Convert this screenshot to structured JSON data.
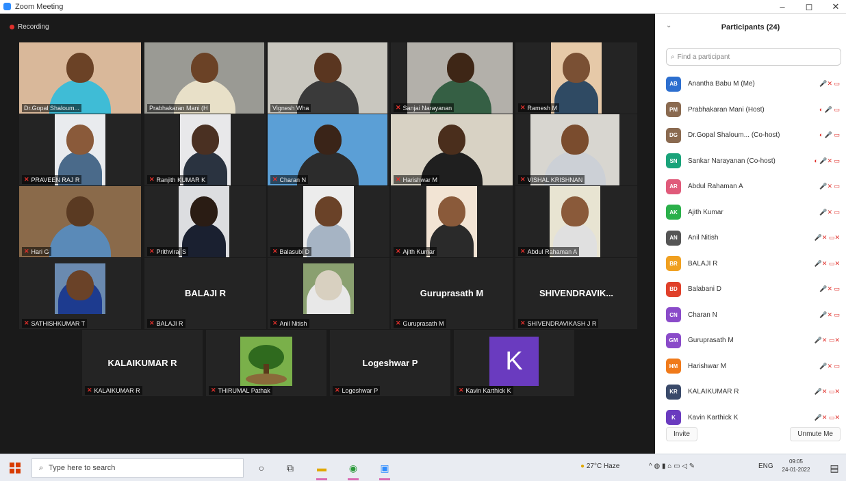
{
  "window": {
    "title": "Zoom Meeting",
    "minimize": "–",
    "maximize": "◻",
    "close": "✕"
  },
  "recording": {
    "label": "Recording"
  },
  "tiles": [
    {
      "name": "Dr.Gopal Shaloum...",
      "muted": false,
      "type": "video",
      "bg": "#d9b89a",
      "skin": "#6b4226",
      "shirt": "#3fbcd6"
    },
    {
      "name": "Prabhakaran Mani (H",
      "muted": false,
      "type": "video",
      "bg": "#9a9a94",
      "skin": "#6b4226",
      "shirt": "#e8e0c8"
    },
    {
      "name": "Vignesh Wha",
      "muted": false,
      "type": "video",
      "bg": "#c9c7bf",
      "skin": "#5a3620",
      "shirt": "#3a3a3a"
    },
    {
      "name": "Sanjai Narayanan",
      "muted": true,
      "type": "video",
      "bg": "#b3b0aa",
      "skin": "#3e2616",
      "shirt": "#355f44"
    },
    {
      "name": "Ramesh M",
      "muted": true,
      "type": "video",
      "bg": "#e6c9a8",
      "skin": "#7a5034",
      "shirt": "#2f4a63"
    },
    {
      "name": "PRAVEEN RAJ R",
      "muted": true,
      "type": "video",
      "bg": "#e9ebee",
      "skin": "#8a5a3a",
      "shirt": "#4a6a8a"
    },
    {
      "name": "Ranjith KUMAR K",
      "muted": true,
      "type": "video",
      "bg": "#e8e8ea",
      "skin": "#4a3022",
      "shirt": "#2a3340"
    },
    {
      "name": "Charan N",
      "muted": true,
      "type": "video",
      "bg": "#5b9fd6",
      "skin": "#3a2418",
      "shirt": "#2c2c2c"
    },
    {
      "name": "Harishwar M",
      "muted": true,
      "type": "video",
      "bg": "#d8d2c4",
      "skin": "#4a2e1c",
      "shirt": "#1f1f1f"
    },
    {
      "name": "VISHAL KRISHNAN",
      "muted": true,
      "type": "video",
      "bg": "#d8d6d0",
      "skin": "#7a4c2e",
      "shirt": "#ccd0d6"
    },
    {
      "name": "Hari G",
      "muted": true,
      "type": "video",
      "bg": "#8a6a4a",
      "skin": "#5a3a22",
      "shirt": "#5a8ab8"
    },
    {
      "name": "Prithviraj S",
      "muted": true,
      "type": "video",
      "bg": "#dcdde0",
      "skin": "#2a1c14",
      "shirt": "#1a2030"
    },
    {
      "name": "Balasubi D",
      "muted": true,
      "type": "video",
      "bg": "#ececec",
      "skin": "#6a4228",
      "shirt": "#a6b4c4"
    },
    {
      "name": "Ajith Kumar",
      "muted": true,
      "type": "video",
      "bg": "#f2e4d4",
      "skin": "#8a5a3a",
      "shirt": "#2a2a2a"
    },
    {
      "name": "Abdul Rahaman A",
      "muted": true,
      "type": "video",
      "bg": "#e8e4d2",
      "skin": "#8a5a3a",
      "shirt": "#e0e0e0"
    },
    {
      "name": "SATHISHKUMAR T",
      "muted": true,
      "type": "video",
      "bg": "#6a8ab0",
      "skin": "#6a4228",
      "shirt": "#1d3b8f"
    },
    {
      "name": "BALAJI R",
      "muted": true,
      "type": "name",
      "display": "BALAJI R"
    },
    {
      "name": "Anil Nitish",
      "muted": true,
      "type": "video",
      "bg": "#8aa070",
      "skin": "#d8d0c0",
      "shirt": "#e8e8e8"
    },
    {
      "name": "Guruprasath M",
      "muted": true,
      "type": "name",
      "display": "Guruprasath M"
    },
    {
      "name": "SHIVENDRAVIKASH J R",
      "muted": true,
      "type": "name",
      "display": "SHIVENDRAVIK..."
    },
    {
      "name": "KALAIKUMAR R",
      "muted": true,
      "type": "name",
      "display": "KALAIKUMAR R"
    },
    {
      "name": "THIRUMAL Pathak",
      "muted": true,
      "type": "tree"
    },
    {
      "name": "Logeshwar P",
      "muted": true,
      "type": "name",
      "display": "Logeshwar P"
    },
    {
      "name": "Kavin Karthick K",
      "muted": true,
      "type": "letter",
      "display": "K"
    }
  ],
  "panel": {
    "title": "Participants (24)",
    "collapse": "⌄",
    "search_placeholder": "Find a participant",
    "participants": [
      {
        "initials": "AB",
        "color": "#2d6fcf",
        "name": "Anantha Babu M (Me)",
        "icons": "🎤✕  ▭"
      },
      {
        "initials": "PM",
        "color": "#8a6a50",
        "name": "Prabhakaran Mani (Host)",
        "icons": "◐ 🎤 ▭"
      },
      {
        "initials": "DG",
        "color": "#8a6a50",
        "name": "Dr.Gopal Shaloum... (Co-host)",
        "icons": "◐ 🎤 ▭"
      },
      {
        "initials": "SN",
        "color": "#1aa37a",
        "name": "Sankar Narayanan (Co-host)",
        "icons": "◐ 🎤✕ ▭"
      },
      {
        "initials": "AR",
        "color": "#e05a7a",
        "name": "Abdul Rahaman A",
        "icons": "🎤✕ ▭"
      },
      {
        "initials": "AK",
        "color": "#2bb04a",
        "name": "Ajith Kumar",
        "icons": "🎤✕ ▭"
      },
      {
        "initials": "AN",
        "color": "#555555",
        "name": "Anil Nitish",
        "icons": "🎤✕ ▭✕"
      },
      {
        "initials": "BR",
        "color": "#f0a020",
        "name": "BALAJI R",
        "icons": "🎤✕ ▭✕"
      },
      {
        "initials": "BD",
        "color": "#e0402a",
        "name": "Balabani D",
        "icons": "🎤✕ ▭"
      },
      {
        "initials": "CN",
        "color": "#8a4bc9",
        "name": "Charan N",
        "icons": "🎤✕ ▭"
      },
      {
        "initials": "GM",
        "color": "#8a4bc9",
        "name": "Guruprasath M",
        "icons": "🎤✕ ▭✕"
      },
      {
        "initials": "HM",
        "color": "#f07a1a",
        "name": "Harishwar M",
        "icons": "🎤✕ ▭"
      },
      {
        "initials": "KR",
        "color": "#3a4a6a",
        "name": "KALAIKUMAR R",
        "icons": "🎤✕ ▭✕"
      },
      {
        "initials": "K",
        "color": "#6a3bbf",
        "name": "Kavin Karthick K",
        "icons": "🎤✕ ▭✕"
      }
    ],
    "invite": "Invite",
    "unmute": "Unmute Me"
  },
  "taskbar": {
    "search_placeholder": "Type here to search",
    "weather": "27°C Haze",
    "language": "ENG",
    "time": "09:05",
    "date": "24-01-2022"
  }
}
